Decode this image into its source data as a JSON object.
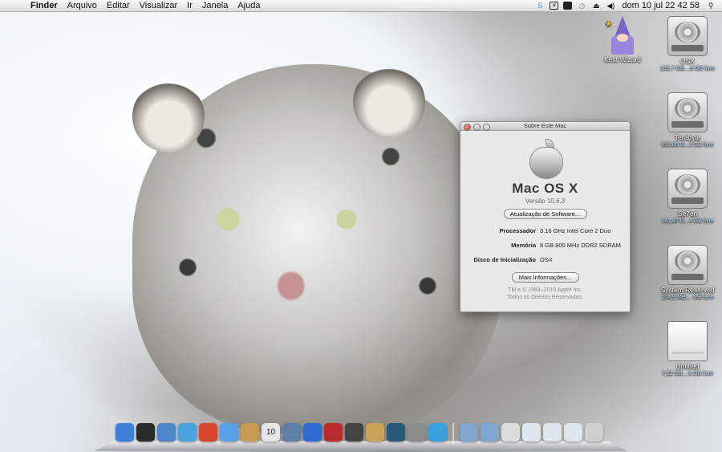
{
  "menubar": {
    "apple_symbol": "",
    "app_name": "Finder",
    "items": [
      "Arquivo",
      "Editar",
      "Visualizar",
      "Ir",
      "Janela",
      "Ajuda"
    ],
    "clock": "dom 10 jul  22 42 58",
    "status_icons": [
      "skype-icon",
      "x-app-icon",
      "display-icon",
      "time-machine-icon",
      "eject-icon",
      "volume-icon",
      "spotlight-icon"
    ]
  },
  "desktop": {
    "kext_wizard": {
      "label": "Kext Wizard"
    },
    "disks": [
      {
        "name": "OSX",
        "sub": "195,7 GB,...8 GB livre"
      },
      {
        "name": "Terabyte",
        "sub": "999,86 G...2 GB livre"
      },
      {
        "name": "Se7en",
        "sub": "141,45 G...4 GB livre"
      },
      {
        "name": "System Reserved",
        "sub": "104,9 MB,... MB livre"
      },
      {
        "name": "Untitled",
        "sub": "7,52 GB,...6 GB livre"
      }
    ]
  },
  "about": {
    "title": "Sobre Este Mac",
    "os_name": "Mac OS X",
    "version": "Versão 10.6.3",
    "update_button": "Atualização de Software...",
    "processor_label": "Processador",
    "processor_value": "3.16 GHz Intel Core 2 Duo",
    "memory_label": "Memória",
    "memory_value": "8 GB 800 MHz DDR2 SDRAM",
    "startup_label": "Disco de Inicialização",
    "startup_value": "OSX",
    "more_button": "Mais Informações...",
    "copyright_1": "TM e © 1983–2010 Apple Inc.",
    "copyright_2": "Todos os Direitos Reservados."
  },
  "dock": {
    "apps": [
      {
        "name": "finder",
        "color": "#3b7fd6"
      },
      {
        "name": "dashboard",
        "color": "#2b2b2b"
      },
      {
        "name": "preview",
        "color": "#4f86c9"
      },
      {
        "name": "safari",
        "color": "#4aa3df"
      },
      {
        "name": "chrome",
        "color": "#d9462f"
      },
      {
        "name": "ichat",
        "color": "#5aa0e8"
      },
      {
        "name": "address-book",
        "color": "#c99a54"
      },
      {
        "name": "ical",
        "color": "#e6e6e6"
      },
      {
        "name": "iphoto",
        "color": "#5d7fa8"
      },
      {
        "name": "itunes",
        "color": "#2d6bd0"
      },
      {
        "name": "photo-booth",
        "color": "#b92b2b"
      },
      {
        "name": "front-row",
        "color": "#444444"
      },
      {
        "name": "garageband",
        "color": "#c9a35a"
      },
      {
        "name": "time-machine",
        "color": "#2a5a78"
      },
      {
        "name": "system-preferences",
        "color": "#8c8c8c"
      },
      {
        "name": "messenger",
        "color": "#39a0e0"
      }
    ],
    "folders": [
      {
        "name": "applications-folder",
        "color": "#7ea6cf"
      },
      {
        "name": "documents-folder",
        "color": "#7ea6cf"
      },
      {
        "name": "security-shield",
        "color": "#dcdcdc"
      },
      {
        "name": "network-stack",
        "color": "#e0e6ee"
      },
      {
        "name": "downloads-stack",
        "color": "#e0e6ee"
      },
      {
        "name": "system-stack",
        "color": "#e0e6ee"
      },
      {
        "name": "trash",
        "color": "#cfcfcf"
      }
    ],
    "calendar_day": "10"
  }
}
